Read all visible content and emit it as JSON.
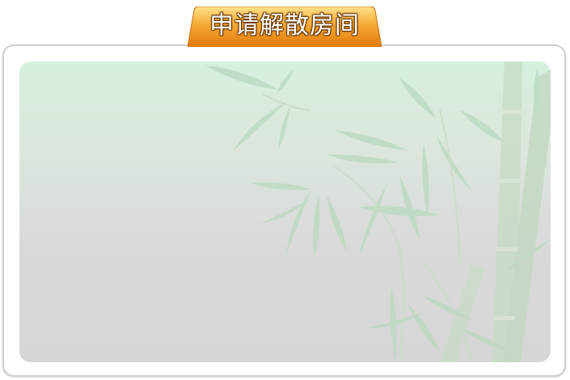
{
  "dialog": {
    "title": "申请解散房间",
    "tab_color": "#f29a1c",
    "panel_color": "#ffffff",
    "background_art": "bamboo-illustration"
  }
}
